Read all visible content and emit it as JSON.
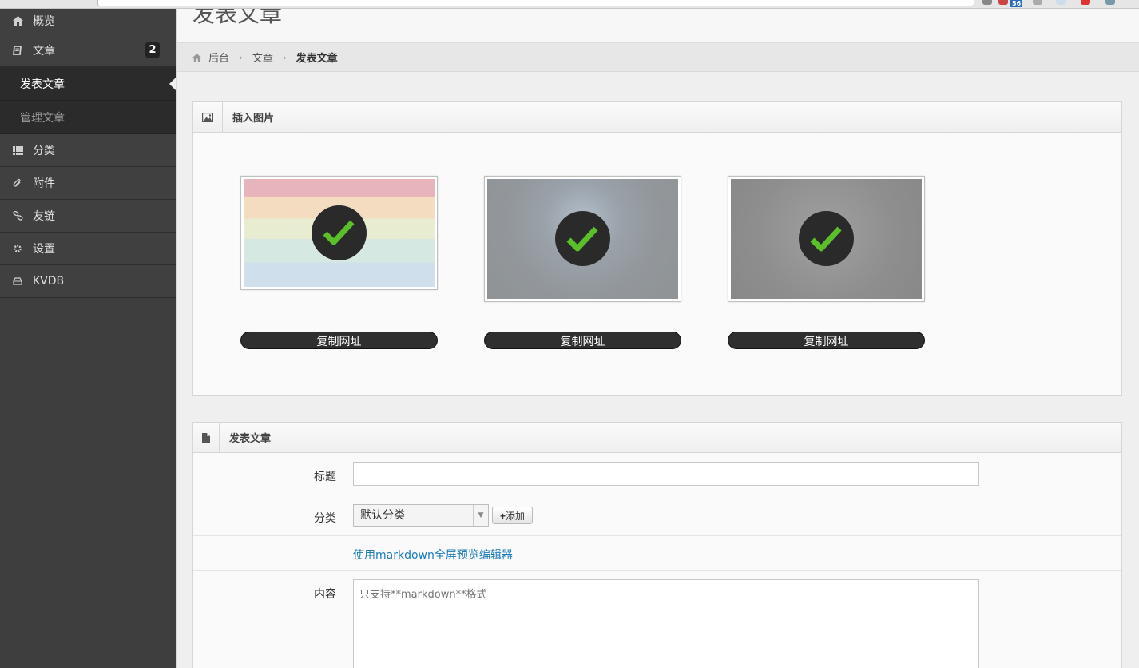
{
  "sidebar": {
    "items": [
      {
        "label": "概览",
        "icon": "home-icon"
      },
      {
        "label": "文章",
        "icon": "book-icon",
        "badge": "2"
      },
      {
        "label": "分类",
        "icon": "list-icon"
      },
      {
        "label": "附件",
        "icon": "paperclip-icon"
      },
      {
        "label": "友链",
        "icon": "link-icon"
      },
      {
        "label": "设置",
        "icon": "gear-icon"
      },
      {
        "label": "KVDB",
        "icon": "database-icon"
      }
    ],
    "sub_items": [
      {
        "label": "发表文章",
        "active": true
      },
      {
        "label": "管理文章",
        "active": false
      }
    ]
  },
  "page": {
    "title": "发表文章"
  },
  "breadcrumb": {
    "items": [
      "后台",
      "文章",
      "发表文章"
    ]
  },
  "insert_panel": {
    "title": "插入图片",
    "images": [
      {
        "name": "pastel-stripes-image",
        "copy_label": "复制网址"
      },
      {
        "name": "grey-blue-glow-image",
        "copy_label": "复制网址"
      },
      {
        "name": "grey-apple-texture-image",
        "copy_label": "复制网址"
      }
    ]
  },
  "post_panel": {
    "title": "发表文章",
    "fields": {
      "title_label": "标题",
      "title_value": "",
      "category_label": "分类",
      "category_value": "默认分类",
      "add_label": "添加",
      "markdown_link": "使用markdown全屏预览编辑器",
      "content_label": "内容",
      "content_placeholder": "只支持**markdown**格式"
    }
  },
  "browser": {
    "badge": "56"
  },
  "colors": {
    "sidebar_bg": "#3e3e3e",
    "submenu_bg": "#2b2b2b",
    "link": "#1a7ab8",
    "check_green": "#5bbf2a"
  }
}
